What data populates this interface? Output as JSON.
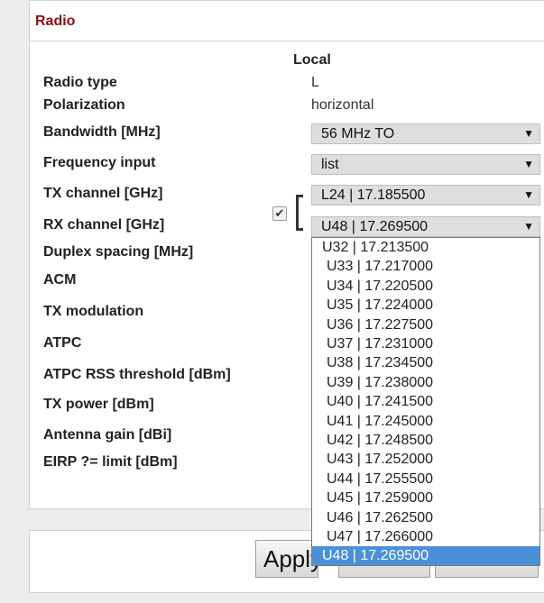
{
  "panel": {
    "title": "Radio",
    "column_header": "Local"
  },
  "rows": {
    "radio_type": {
      "label": "Radio type",
      "value": "L"
    },
    "polarization": {
      "label": "Polarization",
      "value": "horizontal"
    },
    "bandwidth": {
      "label": "Bandwidth [MHz]",
      "value": "56 MHz TO"
    },
    "frequency_input": {
      "label": "Frequency input",
      "value": "list"
    },
    "tx_channel": {
      "label": "TX channel [GHz]",
      "value": "L24 | 17.185500"
    },
    "rx_channel": {
      "label": "RX channel [GHz]",
      "value": "U48 | 17.269500"
    },
    "duplex_spacing": {
      "label": "Duplex spacing [MHz]"
    },
    "acm": {
      "label": "ACM"
    },
    "tx_modulation": {
      "label": "TX modulation"
    },
    "atpc": {
      "label": "ATPC"
    },
    "atpc_rss_threshold": {
      "label": "ATPC RSS threshold [dBm]"
    },
    "tx_power": {
      "label": "TX power [dBm]"
    },
    "antenna_gain": {
      "label": "Antenna gain [dBi]"
    },
    "eirp_limit": {
      "label": "EIRP ?= limit [dBm]"
    }
  },
  "channel_link": {
    "checked": true,
    "check_glyph": "✔"
  },
  "dropdown": {
    "options": [
      "U32 | 17.213500",
      "U33 | 17.217000",
      "U34 | 17.220500",
      "U35 | 17.224000",
      "U36 | 17.227500",
      "U37 | 17.231000",
      "U38 | 17.234500",
      "U39 | 17.238000",
      "U40 | 17.241500",
      "U41 | 17.245000",
      "U42 | 17.248500",
      "U43 | 17.252000",
      "U44 | 17.255500",
      "U45 | 17.259000",
      "U46 | 17.262500",
      "U47 | 17.266000",
      "U48 | 17.269500"
    ],
    "selected": "U48 | 17.269500"
  },
  "buttons": {
    "apply_label": "Apply"
  },
  "icons": {
    "select_arrow": "▼"
  },
  "colors": {
    "title": "#8b1010",
    "highlight": "#4a90d9"
  }
}
